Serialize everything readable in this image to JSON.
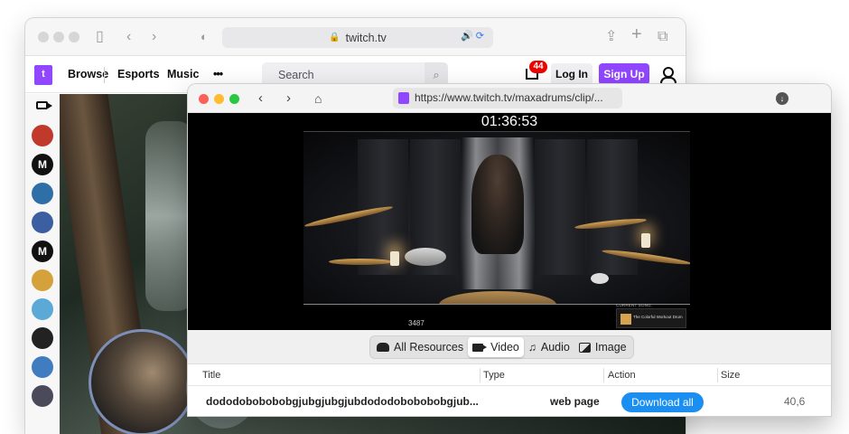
{
  "safari": {
    "url": "twitch.tv"
  },
  "twitch": {
    "logo_letter": "t",
    "nav": [
      "Browse",
      "Esports",
      "Music"
    ],
    "more": "•••",
    "search_placeholder": "Search",
    "notification_count": "44",
    "login_label": "Log In",
    "signup_label": "Sign Up",
    "sidebar_avatars": [
      {
        "letter": "",
        "color": "#c0392b"
      },
      {
        "letter": "M",
        "color": "#111111"
      },
      {
        "letter": "",
        "color": "#2e6fa7"
      },
      {
        "letter": "",
        "color": "#3b5fa0"
      },
      {
        "letter": "M",
        "color": "#111111"
      },
      {
        "letter": "",
        "color": "#d4a13a"
      },
      {
        "letter": "",
        "color": "#5aa9d6"
      },
      {
        "letter": "",
        "color": "#222222"
      },
      {
        "letter": "",
        "color": "#3f7cc0"
      },
      {
        "letter": "",
        "color": "#4a4a5a"
      }
    ]
  },
  "downloader": {
    "url": "https://www.twitch.tv/maxadrums/clip/...",
    "timer": "01:36:53",
    "viewer_count": "3487",
    "current_song_label": "CURRENT SONG:",
    "song_text": "The Colorful Workout Drum",
    "filters": [
      {
        "label": "All Resources",
        "icon": "cloud-icon",
        "active": false
      },
      {
        "label": "Video",
        "icon": "video-camera-icon",
        "active": true
      },
      {
        "label": "Audio",
        "icon": "music-note-icon",
        "active": false
      },
      {
        "label": "Image",
        "icon": "image-icon",
        "active": false
      }
    ],
    "columns": [
      "Title",
      "Type",
      "Action",
      "Size"
    ],
    "rows": [
      {
        "title": "dododobobobobgjubgjubgjubdododobobobobgjub...",
        "type": "web page",
        "action": "Download all",
        "size": "40,6"
      }
    ]
  },
  "colors": {
    "twitch_purple": "#9146ff",
    "download_blue": "#1a8ef1",
    "badge_red": "#eb0400"
  }
}
